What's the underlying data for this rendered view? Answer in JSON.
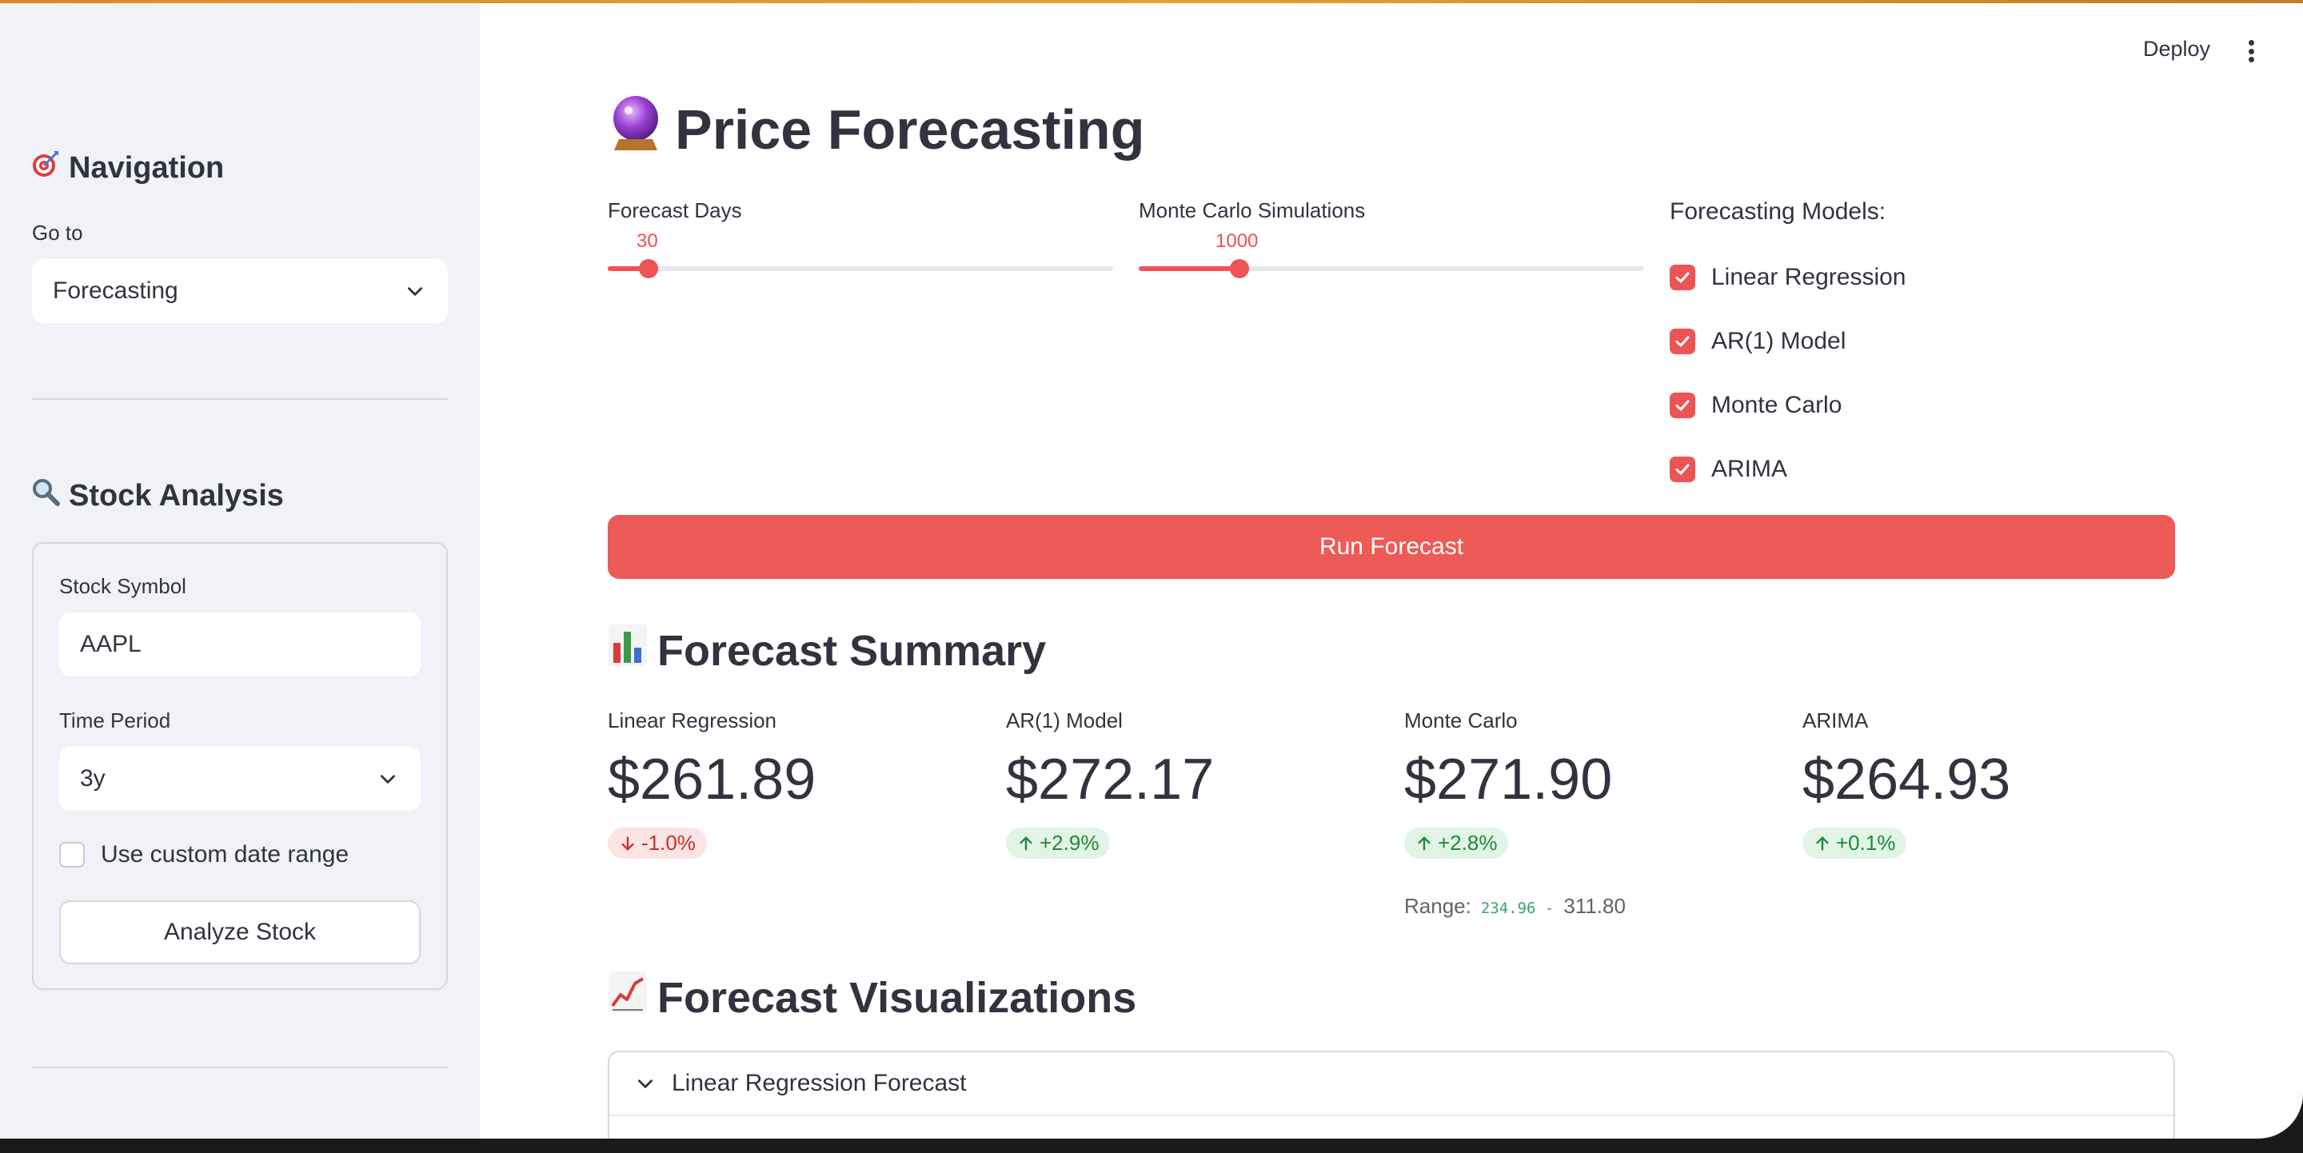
{
  "header": {
    "deploy_label": "Deploy",
    "menu_icon": "kebab-menu-icon"
  },
  "sidebar": {
    "navigation_heading": "Navigation",
    "goto_label": "Go to",
    "goto_value": "Forecasting",
    "stock_heading": "Stock Analysis",
    "symbol_label": "Stock Symbol",
    "symbol_value": "AAPL",
    "period_label": "Time Period",
    "period_value": "3y",
    "custom_range_label": "Use custom date range",
    "analyze_button": "Analyze Stock"
  },
  "main": {
    "title": "Price Forecasting",
    "forecast_days": {
      "label": "Forecast Days",
      "value": "30",
      "fraction": 0.08
    },
    "monte_carlo_sims": {
      "label": "Monte Carlo Simulations",
      "value": "1000",
      "fraction": 0.2
    },
    "models_label": "Forecasting Models:",
    "models": [
      {
        "label": "Linear Regression",
        "checked": true
      },
      {
        "label": "AR(1) Model",
        "checked": true
      },
      {
        "label": "Monte Carlo",
        "checked": true
      },
      {
        "label": "ARIMA",
        "checked": true
      }
    ],
    "run_button": "Run Forecast",
    "summary_heading": "Forecast Summary",
    "metrics": [
      {
        "label": "Linear Regression",
        "value": "$261.89",
        "delta": "-1.0%",
        "direction": "down"
      },
      {
        "label": "AR(1) Model",
        "value": "$272.17",
        "delta": "+2.9%",
        "direction": "up"
      },
      {
        "label": "Monte Carlo",
        "value": "$271.90",
        "delta": "+2.8%",
        "direction": "up"
      },
      {
        "label": "ARIMA",
        "value": "$264.93",
        "delta": "+0.1%",
        "direction": "up"
      }
    ],
    "range": {
      "label": "Range:",
      "low": "234.96 -",
      "high": "311.80"
    },
    "viz_heading": "Forecast Visualizations",
    "expander_label": "Linear Regression Forecast"
  },
  "colors": {
    "accent": "#ee5453",
    "sidebar_bg": "#f0f2f6",
    "positive": "#1e8a3a",
    "negative": "#c2302f"
  }
}
